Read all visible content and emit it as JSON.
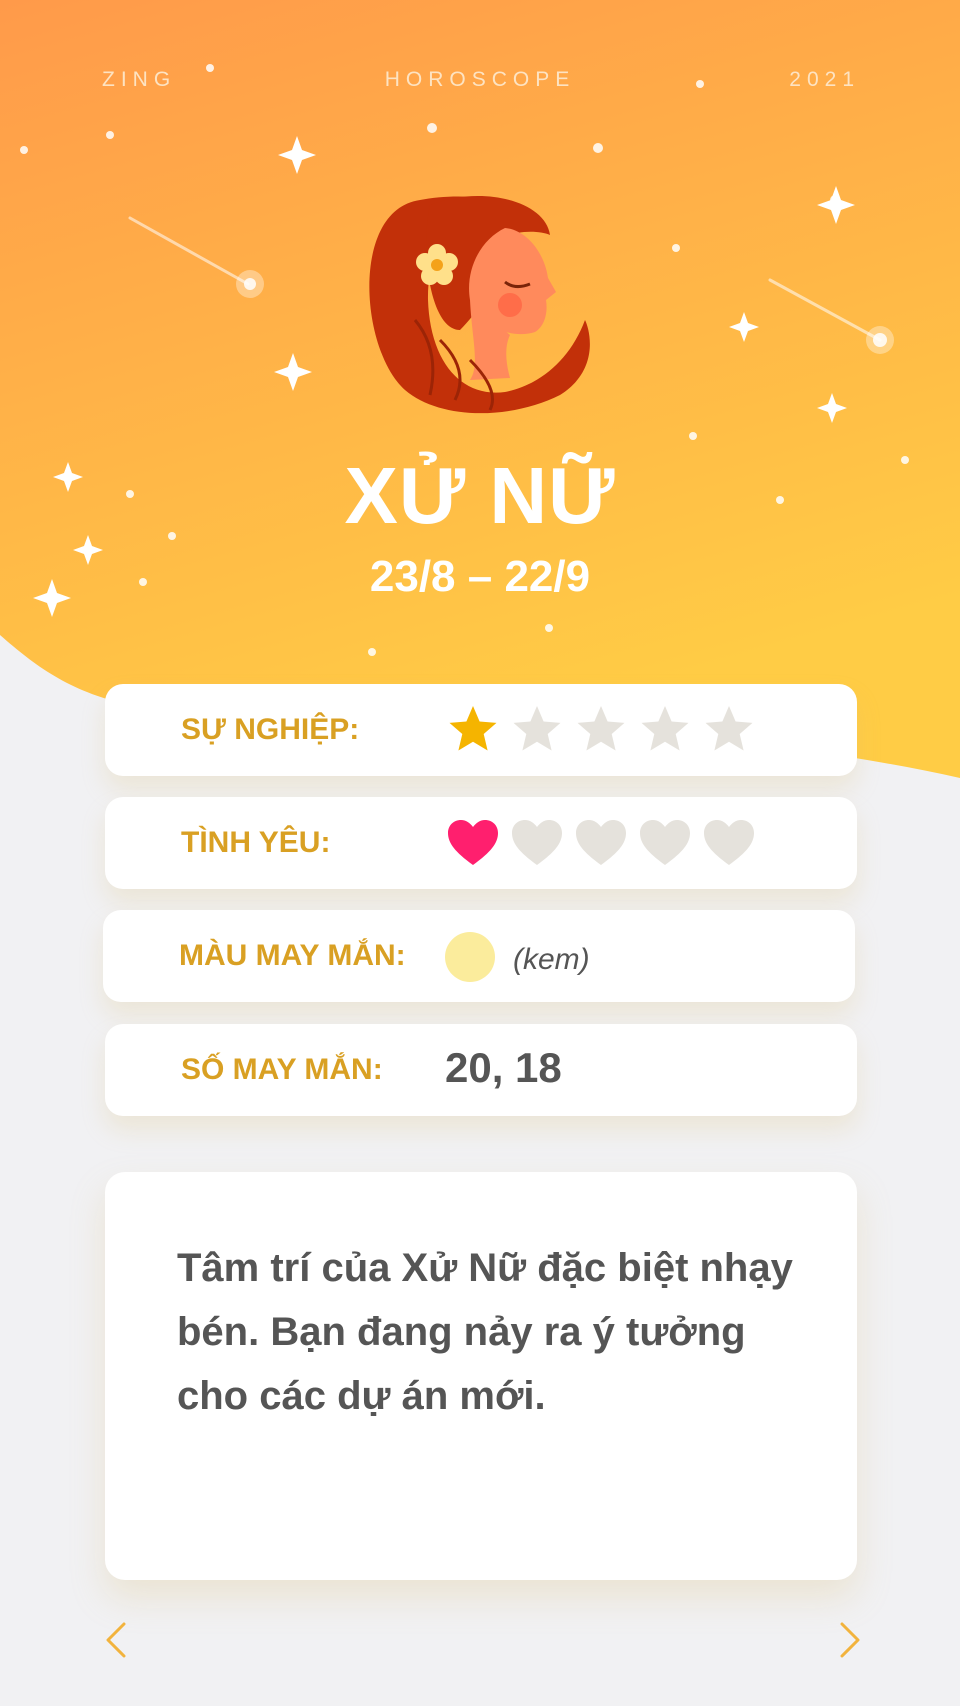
{
  "header": {
    "left": "ZING",
    "center": "HOROSCOPE",
    "right": "2021"
  },
  "sign": {
    "name": "XỬ NỮ",
    "dates": "23/8 – 22/9",
    "emblem": "virgo-woman-icon"
  },
  "colors": {
    "hero_top": "#ff9a4a",
    "hero_bottom": "#ffcc45",
    "label": "#d9a023",
    "star_active": "#f5b400",
    "heart_active": "#ff1f6e",
    "inactive": "#e5e2dc",
    "lucky_color": "#fbec9c"
  },
  "stats": {
    "career": {
      "label": "SỰ NGHIỆP:",
      "rating": 1,
      "max": 5,
      "icon": "star-icon"
    },
    "love": {
      "label": "TÌNH YÊU:",
      "rating": 1,
      "max": 5,
      "icon": "heart-icon"
    },
    "lucky_color": {
      "label": "MÀU MAY MẮN:",
      "value": "(kem)"
    },
    "lucky_number": {
      "label": "SỐ MAY MẮN:",
      "value": "20, 18"
    }
  },
  "description": "Tâm trí của Xử Nữ đặc biệt nhạy bén. Bạn đang nảy ra ý tưởng cho các dự án mới.",
  "nav": {
    "prev": "chevron-left-icon",
    "next": "chevron-right-icon"
  }
}
